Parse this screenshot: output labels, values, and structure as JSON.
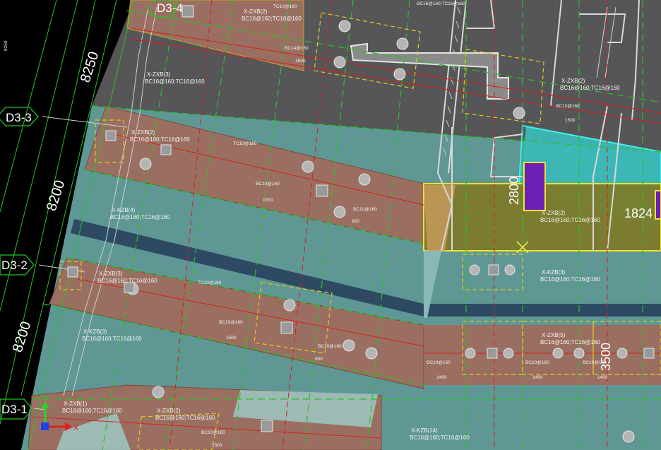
{
  "drawing": {
    "grid_axes": [
      {
        "label": "D3-4"
      },
      {
        "label": "D3-3"
      },
      {
        "label": "D3-2"
      },
      {
        "label": "D3-1"
      }
    ],
    "bay_dimensions": [
      "8250",
      "8200",
      "8200"
    ],
    "dimension_values": {
      "d2800": "2800",
      "d1824": "1824",
      "d3500": "3500"
    },
    "beam_labels": [
      {
        "text": "X-ZXB(2)"
      },
      {
        "text": "BC16@160;TC16@160"
      },
      {
        "text": "X-ZXB(3)"
      },
      {
        "text": "BC16@160;TC16@160"
      },
      {
        "text": "X-ZXB(2)"
      },
      {
        "text": "BC16@160;TC16@160"
      },
      {
        "text": "X-ZXB(2)"
      },
      {
        "text": "BC16@160;TC16@160"
      },
      {
        "text": "X-KZB(4)"
      },
      {
        "text": "BC16@160;TC16@160"
      },
      {
        "text": "X-ZXB(2)"
      },
      {
        "text": "BC16@160;TC16@160"
      },
      {
        "text": "X-ZXB(3)"
      },
      {
        "text": "BC16@160;TC16@160"
      },
      {
        "text": "X-KZB(3)"
      },
      {
        "text": "BC16@160;TC16@160"
      },
      {
        "text": "X-KZB(3)"
      },
      {
        "text": "BC16@160;TC16@160"
      },
      {
        "text": "X-ZXB(5)"
      },
      {
        "text": "BC16@160;TC16@160"
      },
      {
        "text": "X-ZXB(2)"
      },
      {
        "text": "BC16@160;TC16@160"
      },
      {
        "text": "X-KZB(14)"
      },
      {
        "text": "BC16@160;TC16@160"
      },
      {
        "text": "X-ZXB(1)"
      },
      {
        "text": "BC16@160;TC16@160"
      }
    ],
    "rebar_notes": [
      {
        "text": "TC10@160"
      },
      {
        "text": "BC14@160"
      },
      {
        "text": "1500"
      },
      {
        "text": "BC12@160"
      },
      {
        "text": "1500"
      },
      {
        "text": "TC10@160"
      },
      {
        "text": "BC10@160"
      },
      {
        "text": "1500"
      },
      {
        "text": "BC10@160"
      },
      {
        "text": "900"
      },
      {
        "text": "TC10@160"
      },
      {
        "text": "BC10@160"
      },
      {
        "text": "1500"
      },
      {
        "text": "BC10@160"
      },
      {
        "text": "900"
      },
      {
        "text": "BC10@160"
      },
      {
        "text": "1400"
      },
      {
        "text": "BC10@160"
      },
      {
        "text": "1400"
      },
      {
        "text": "BC10@160"
      },
      {
        "text": "1400"
      },
      {
        "text": "BC10@160"
      },
      {
        "text": "1500"
      },
      {
        "text": "BC16@160;TC16@160"
      },
      {
        "text": "8250"
      }
    ],
    "ucs": {
      "x_label": "X",
      "y_label": "Y"
    },
    "colors": {
      "background": "#000000",
      "slab_dark": "#555558",
      "slab_teal": "#5f9795",
      "strip_salmon": "#9a6f61",
      "cyan_zone": "#3bb8b6",
      "olive_zone": "#7e7a26",
      "purple_block": "#6b1fb3",
      "dark_band": "#2e4a63",
      "grid_green": "#27c227",
      "yellow_dash": "#e3cc1d",
      "red_line": "#d42020",
      "white": "#ffffff"
    }
  }
}
